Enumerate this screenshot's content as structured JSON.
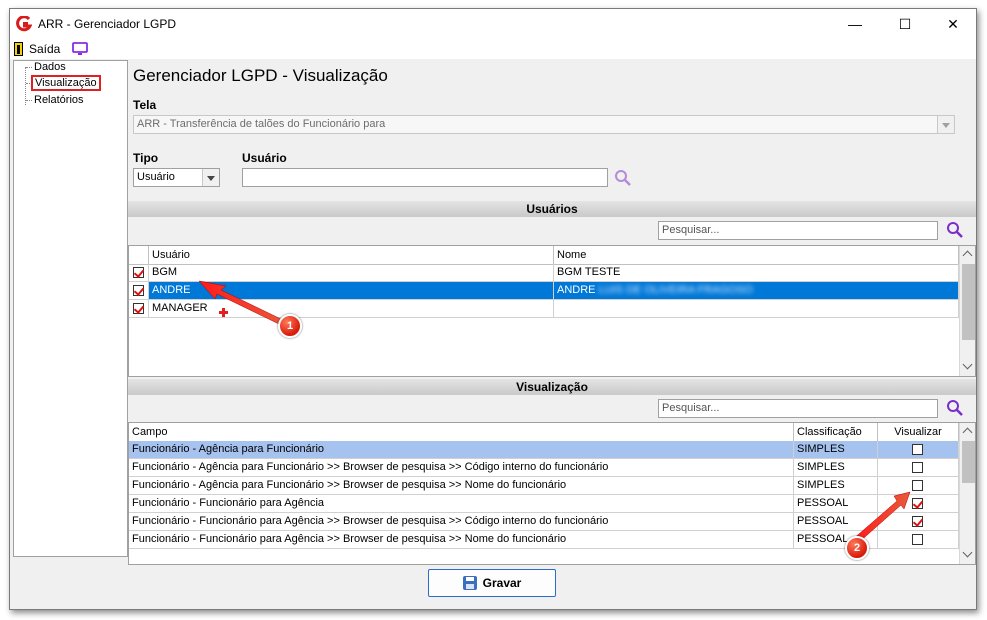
{
  "window": {
    "title": "ARR - Gerenciador LGPD",
    "minimize": "—",
    "maximize": "☐",
    "close": "✕"
  },
  "menu": {
    "exit_label": "Saída"
  },
  "tree": {
    "items": [
      {
        "label": "Dados"
      },
      {
        "label": "Visualização",
        "selected": true
      },
      {
        "label": "Relatórios"
      }
    ]
  },
  "page": {
    "title": "Gerenciador LGPD - Visualização"
  },
  "tela": {
    "label": "Tela",
    "value": "ARR - Transferência de talões do Funcionário para"
  },
  "tipo": {
    "label": "Tipo",
    "value": "Usuário"
  },
  "usuario": {
    "label": "Usuário",
    "value": ""
  },
  "usuarios_section": {
    "title": "Usuários",
    "search_placeholder": "Pesquisar...",
    "columns": [
      "Usuário",
      "Nome"
    ],
    "rows": [
      {
        "checked": true,
        "user": "BGM",
        "name": "BGM TESTE",
        "selected": false
      },
      {
        "checked": true,
        "user": "ANDRE",
        "name": "ANDRE",
        "name_blurred": "LUIS DE OLIVEIRA FRAGOSO",
        "selected": true
      },
      {
        "checked": true,
        "user": "MANAGER",
        "name": "",
        "selected": false
      }
    ]
  },
  "visualizacao_section": {
    "title": "Visualização",
    "search_placeholder": "Pesquisar...",
    "columns": [
      "Campo",
      "Classificação",
      "Visualizar"
    ],
    "rows": [
      {
        "campo": "Funcionário - Agência para Funcionário",
        "classificacao": "SIMPLES",
        "visualizar": false,
        "selected": true
      },
      {
        "campo": "Funcionário - Agência para Funcionário >> Browser de pesquisa >> Código interno do funcionário",
        "classificacao": "SIMPLES",
        "visualizar": false,
        "selected": false
      },
      {
        "campo": "Funcionário - Agência para Funcionário >> Browser de pesquisa >> Nome do funcionário",
        "classificacao": "SIMPLES",
        "visualizar": false,
        "selected": false
      },
      {
        "campo": "Funcionário - Funcionário para Agência",
        "classificacao": "PESSOAL",
        "visualizar": true,
        "selected": false
      },
      {
        "campo": "Funcionário - Funcionário para Agência >> Browser de pesquisa >> Código interno do funcionário",
        "classificacao": "PESSOAL",
        "visualizar": true,
        "selected": false
      },
      {
        "campo": "Funcionário - Funcionário para Agência >> Browser de pesquisa >> Nome do funcionário",
        "classificacao": "PESSOAL",
        "visualizar": false,
        "selected": false
      }
    ]
  },
  "footer": {
    "save_label": "Gravar"
  },
  "annotations": {
    "callout_1": "1",
    "callout_2": "2"
  },
  "colors": {
    "accent_blue": "#0078d7",
    "highlight_row": "#a6c2ee",
    "annotation_red": "#e02020",
    "search_purple": "#7a2fc8"
  }
}
